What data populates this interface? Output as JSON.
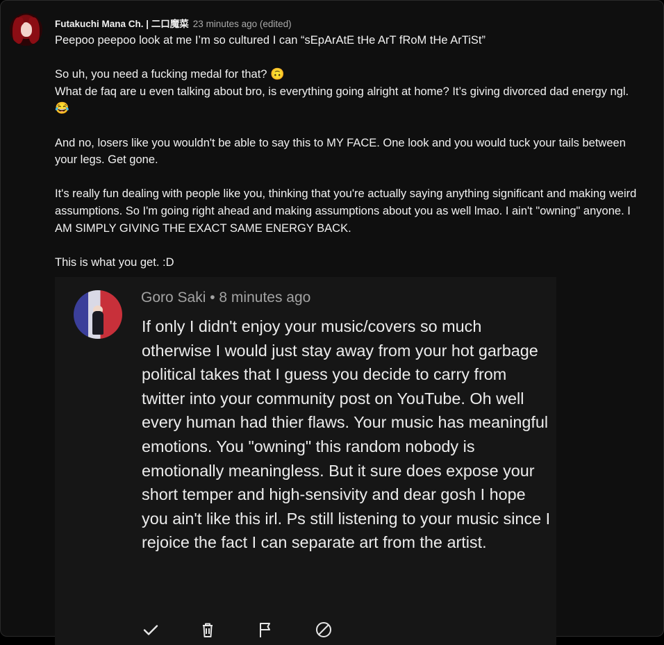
{
  "comment": {
    "author": "Futakuchi Mana Ch. | 二口魔菜",
    "time": "23 minutes ago (edited)",
    "paragraphs": [
      [
        "Peepoo peepoo look at me I’m so cultured I can “sEpArAtE tHe ArT fRoM tHe ArTiSt”"
      ],
      [
        "So uh, you need a fucking medal for that? 🙃",
        "What de faq are u even talking about bro, is everything going alright at home? It’s giving divorced dad energy ngl. 😂"
      ],
      [
        "And no, losers like you wouldn't be able to say this to MY FACE. One look and you would tuck your tails between your legs. Get gone."
      ],
      [
        "It's really fun dealing with people like you, thinking that you're actually saying anything significant and making weird assumptions. So I'm going right ahead and making assumptions about you as well lmao. I ain't \"owning\" anyone. I AM SIMPLY GIVING THE EXACT SAME ENERGY BACK."
      ],
      [
        "This is what you get. :D"
      ]
    ]
  },
  "embedded_comment": {
    "author": "Goro Saki",
    "separator": "•",
    "time": "8 minutes ago",
    "text": "If only I didn't enjoy your music/covers so much otherwise I would just stay away from your hot garbage political takes that I guess you decide to carry from twitter into your community post on YouTube. Oh well every human had thier flaws. Your music has meaningful emotions. You \"owning\" this random nobody is emotionally meaningless. But it sure does expose your short temper and high-sensivity and dear gosh I hope you ain't like this irl. Ps still listening to your music since I rejoice the fact I can separate art from the artist.",
    "actions": [
      {
        "icon": "check-icon"
      },
      {
        "icon": "trash-icon"
      },
      {
        "icon": "flag-icon"
      },
      {
        "icon": "block-icon"
      }
    ]
  },
  "colors": {
    "background": "#0f0f0f",
    "text": "#f1f1f1",
    "secondary_text": "#aaaaaa",
    "embed_background": "#161616"
  }
}
